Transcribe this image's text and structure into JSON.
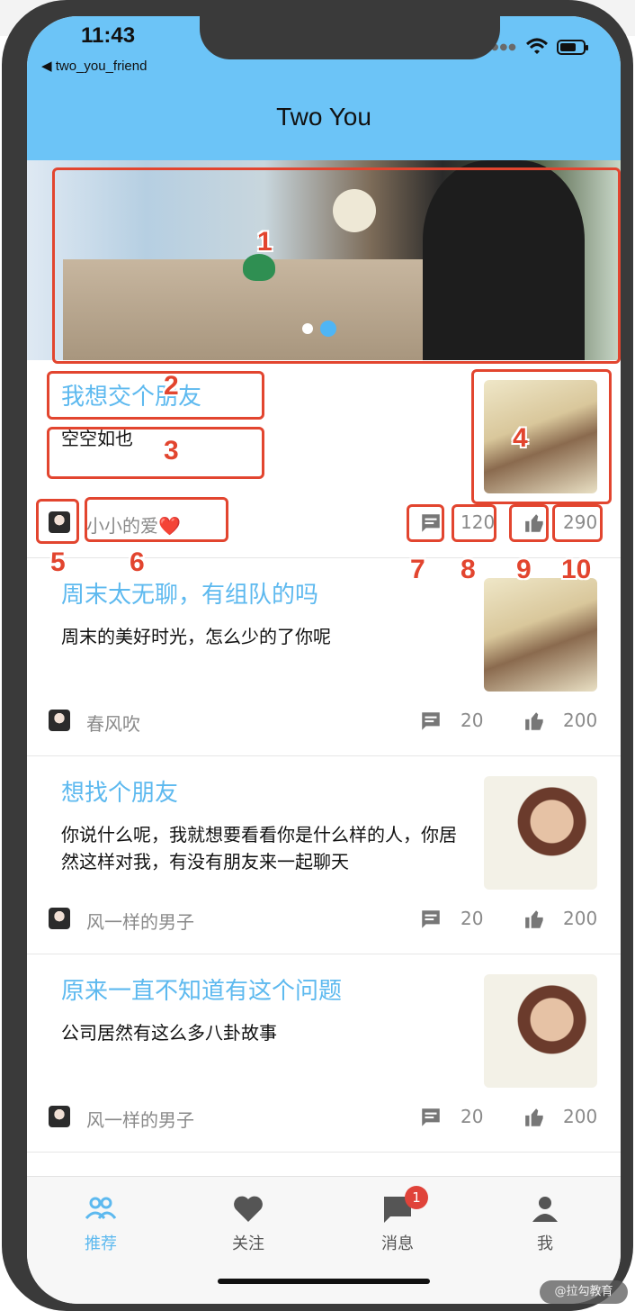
{
  "status_bar": {
    "time": "11:43",
    "back_app": "◀ two_you_friend"
  },
  "app_bar": {
    "title": "Two You"
  },
  "colors": {
    "accent": "#5db9ef",
    "app_bar": "#6cc4f7",
    "badge": "#e0433a",
    "annotation": "#e2452f"
  },
  "banner": {
    "active_dot_index": 1,
    "dot_count": 2
  },
  "feed": [
    {
      "title": "我想交个朋友",
      "desc": "空空如也",
      "author": "小小的爱❤️",
      "comments": "120",
      "likes": "290"
    },
    {
      "title": "周末太无聊，有组队的吗",
      "desc": "周末的美好时光，怎么少的了你呢",
      "author": "春风吹",
      "comments": "20",
      "likes": "200"
    },
    {
      "title": "想找个朋友",
      "desc": "你说什么呢，我就想要看看你是什么样的人，你居然这样对我，有没有朋友来一起聊天",
      "author": "风一样的男子",
      "comments": "20",
      "likes": "200"
    },
    {
      "title": "原来一直不知道有这个问题",
      "desc": "公司居然有这么多八卦故事",
      "author": "风一样的男子",
      "comments": "20",
      "likes": "200"
    }
  ],
  "tabs": [
    {
      "label": "推荐",
      "icon": "group-icon",
      "active": true
    },
    {
      "label": "关注",
      "icon": "heart-icon",
      "active": false
    },
    {
      "label": "消息",
      "icon": "message-icon",
      "active": false,
      "badge": "1"
    },
    {
      "label": "我",
      "icon": "person-icon",
      "active": false
    }
  ],
  "annotations": [
    "1",
    "2",
    "3",
    "4",
    "5",
    "6",
    "7",
    "8",
    "9",
    "10"
  ],
  "watermark": "@拉勾教育"
}
